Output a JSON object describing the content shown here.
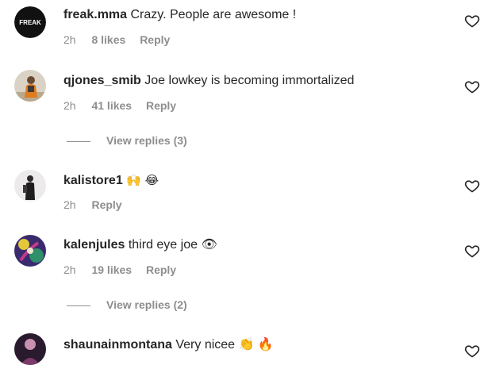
{
  "comments": [
    {
      "username": "freak.mma",
      "text": "Crazy. People are awesome !",
      "time": "2h",
      "likes": "8 likes",
      "reply": "Reply",
      "avatar_text": "FREAK"
    },
    {
      "username": "qjones_smib",
      "text": "Joe lowkey is becoming immortalized",
      "time": "2h",
      "likes": "41 likes",
      "reply": "Reply",
      "view_replies": "View replies (3)"
    },
    {
      "username": "kalistore1",
      "text": "🙌 😂",
      "time": "2h",
      "reply": "Reply"
    },
    {
      "username": "kalenjules",
      "text": "third eye joe 👁",
      "time": "2h",
      "likes": "19 likes",
      "reply": "Reply",
      "view_replies": "View replies (2)"
    },
    {
      "username": "shaunainmontana",
      "text": "Very nicee 👏 🔥"
    }
  ],
  "colors": {
    "primary_text": "#262626",
    "secondary_text": "#8e8e8e",
    "background": "#ffffff"
  },
  "icons": {
    "like": "heart-outline-icon"
  }
}
